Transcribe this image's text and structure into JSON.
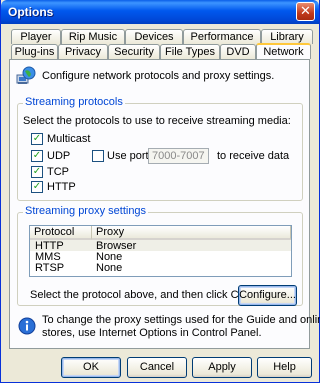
{
  "window": {
    "title": "Options",
    "close_glyph": "✕"
  },
  "tabs": {
    "row1": [
      "Player",
      "Rip Music",
      "Devices",
      "Performance",
      "Library"
    ],
    "row2": [
      "Plug-ins",
      "Privacy",
      "Security",
      "File Types",
      "DVD",
      "Network"
    ],
    "active": "Network"
  },
  "intro": {
    "text": "Configure network protocols and proxy settings.",
    "icon": "network-globe-icon"
  },
  "streaming_protocols": {
    "title": "Streaming protocols",
    "instruction": "Select the protocols to use to receive streaming media:",
    "multicast": {
      "label": "Multicast",
      "checked": true
    },
    "udp": {
      "label": "UDP",
      "checked": true
    },
    "use_ports": {
      "label": "Use ports",
      "checked": false,
      "value": "7000-7007",
      "suffix": "to receive data"
    },
    "tcp": {
      "label": "TCP",
      "checked": true
    },
    "http": {
      "label": "HTTP",
      "checked": true
    }
  },
  "proxy_settings": {
    "title": "Streaming proxy settings",
    "columns": [
      "Protocol",
      "Proxy"
    ],
    "rows": [
      {
        "protocol": "HTTP",
        "proxy": "Browser"
      },
      {
        "protocol": "MMS",
        "proxy": "None"
      },
      {
        "protocol": "RTSP",
        "proxy": "None"
      }
    ],
    "instruction": "Select the protocol above, and then click Configure.",
    "configure_button": "Configure..."
  },
  "info": {
    "icon": "info-icon",
    "text_line1": "To change the proxy settings used for the Guide and online",
    "text_line2": "stores, use Internet Options in Control Panel."
  },
  "buttons": {
    "ok": "OK",
    "cancel": "Cancel",
    "apply": "Apply",
    "help": "Help"
  },
  "colors": {
    "accent": "#0046d5",
    "title_bar": "#0058ee",
    "checkmark": "#21a121"
  }
}
